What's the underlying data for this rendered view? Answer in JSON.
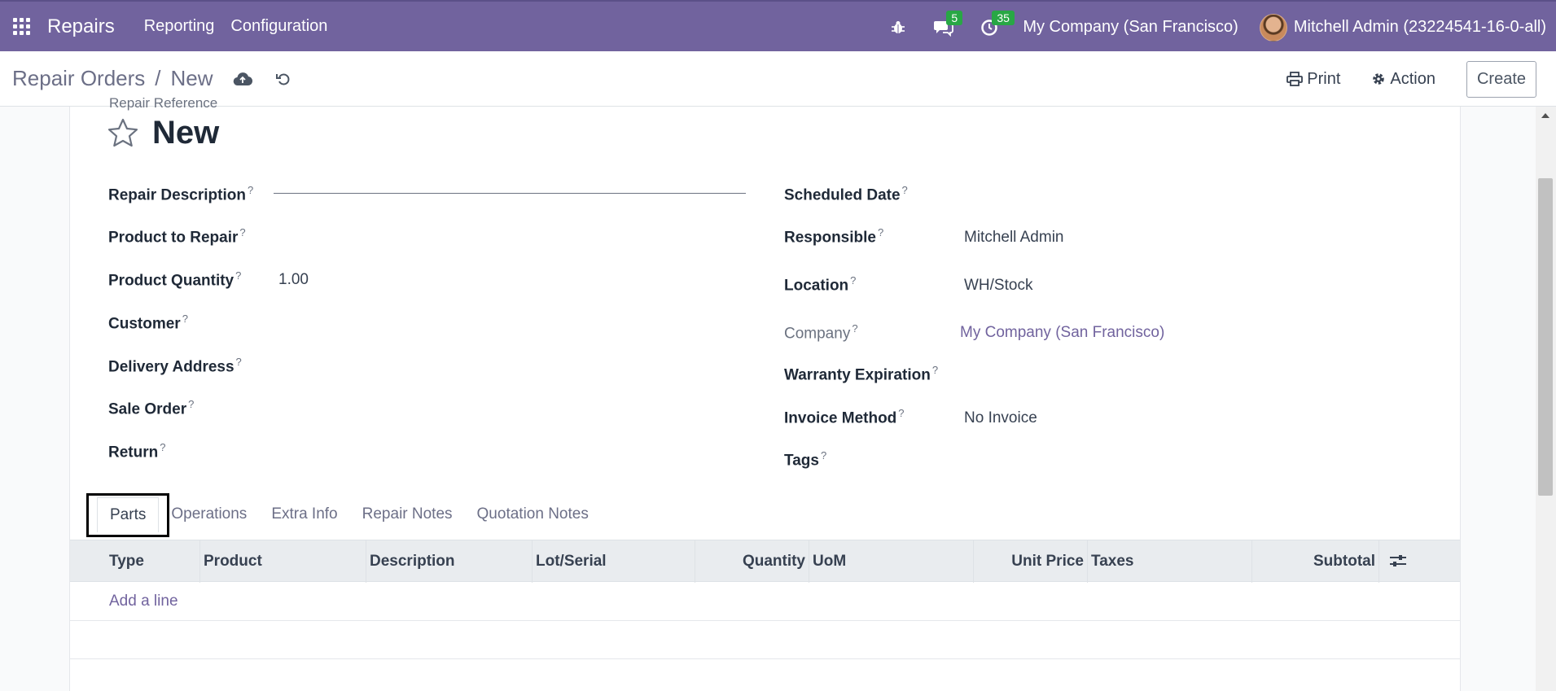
{
  "navbar": {
    "brand": "Repairs",
    "menu": [
      "Reporting",
      "Configuration"
    ],
    "messages_count": "5",
    "activities_count": "35",
    "company": "My Company (San Francisco)",
    "user": "Mitchell Admin (23224541-16-0-all)"
  },
  "control_panel": {
    "breadcrumb_parent": "Repair Orders",
    "breadcrumb_separator": "/",
    "breadcrumb_current": "New",
    "print_label": "Print",
    "action_label": "Action",
    "create_label": "Create"
  },
  "form": {
    "reference_label": "Repair Reference",
    "title": "New",
    "left_fields": {
      "repair_description": {
        "label": "Repair Description",
        "value": ""
      },
      "product_to_repair": {
        "label": "Product to Repair",
        "value": ""
      },
      "product_quantity": {
        "label": "Product Quantity",
        "value": "1.00"
      },
      "customer": {
        "label": "Customer",
        "value": ""
      },
      "delivery_address": {
        "label": "Delivery Address",
        "value": ""
      },
      "sale_order": {
        "label": "Sale Order",
        "value": ""
      },
      "return": {
        "label": "Return",
        "value": ""
      }
    },
    "right_fields": {
      "scheduled_date": {
        "label": "Scheduled Date",
        "value": ""
      },
      "responsible": {
        "label": "Responsible",
        "value": "Mitchell Admin"
      },
      "location": {
        "label": "Location",
        "value": "WH/Stock"
      },
      "company": {
        "label": "Company",
        "value": "My Company (San Francisco)"
      },
      "warranty_expiration": {
        "label": "Warranty Expiration",
        "value": ""
      },
      "invoice_method": {
        "label": "Invoice Method",
        "value": "No Invoice"
      },
      "tags": {
        "label": "Tags",
        "value": ""
      }
    },
    "help_marker": "?"
  },
  "tabs": [
    "Parts",
    "Operations",
    "Extra Info",
    "Repair Notes",
    "Quotation Notes"
  ],
  "table": {
    "columns": [
      "Type",
      "Product",
      "Description",
      "Lot/Serial",
      "Quantity",
      "UoM",
      "Unit Price",
      "Taxes",
      "Subtotal"
    ],
    "add_line": "Add a line"
  },
  "colors": {
    "navbar": "#71639e",
    "link": "#71639e",
    "badge": "#28a745"
  }
}
